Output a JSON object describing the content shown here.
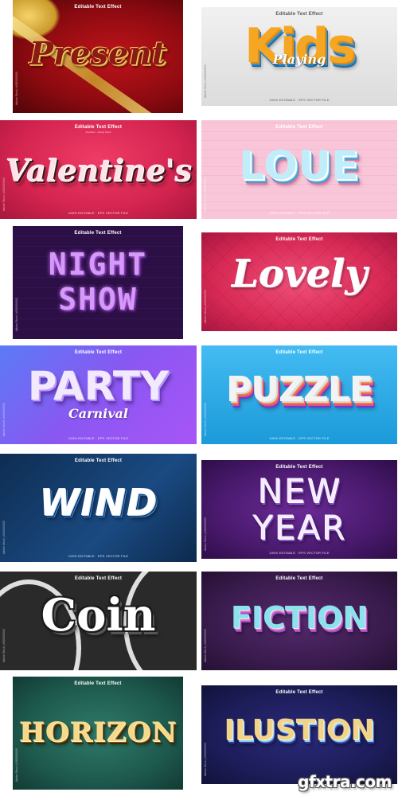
{
  "header_title": "Editable Text Effect",
  "header_sub": "Illustrator · Adobe Stock",
  "footer_text": "100% EDITABLE · EPS VECTOR FILE",
  "side_text": "Adobe Stock | #000000000",
  "tiles": {
    "present": {
      "title": "Present",
      "colors": [
        "#7a0b0d",
        "#c0141a"
      ]
    },
    "kids": {
      "title": "Kids",
      "subtitle": "Playing",
      "colors": [
        "#e3e3e3",
        "#f5a623"
      ]
    },
    "valentines": {
      "title": "Valentine's",
      "colors": [
        "#d8234f",
        "#3a1a1a"
      ]
    },
    "love": {
      "title": "LOUE",
      "colors": [
        "#f9c6d9",
        "#9fd8f2"
      ]
    },
    "night_show": {
      "title_line1": "NIGHT",
      "title_line2": "SHOW",
      "colors": [
        "#3a1659",
        "#c064f0"
      ]
    },
    "lovely": {
      "title": "Lovely",
      "colors": [
        "#e23a62",
        "#ffffff"
      ]
    },
    "party": {
      "title": "PARTY",
      "subtitle": "Carnival",
      "colors": [
        "#7f55f4",
        "#ffffff"
      ]
    },
    "puzzle": {
      "title": "PUZZLE",
      "colors": [
        "#2aa9e8",
        "#f07e3a"
      ]
    },
    "wind": {
      "title": "WIND",
      "colors": [
        "#133a66",
        "#ffffff"
      ]
    },
    "new_year": {
      "title_line1": "NEW",
      "title_line2": "YEAR",
      "colors": [
        "#4a1a6e",
        "#e0c7ff"
      ]
    },
    "coin": {
      "title": "Coin",
      "colors": [
        "#2a2a2a",
        "#ffffff"
      ]
    },
    "fiction": {
      "title": "FICTION",
      "colors": [
        "#3b1c4f",
        "#8be2ec"
      ]
    },
    "horizon": {
      "title": "HORIZON",
      "colors": [
        "#1e5a4e",
        "#d9a53b"
      ]
    },
    "ilustion": {
      "title": "ILUSTION",
      "colors": [
        "#1d1d5a",
        "#f2d38a"
      ]
    }
  },
  "watermark": "gfxtra.com"
}
